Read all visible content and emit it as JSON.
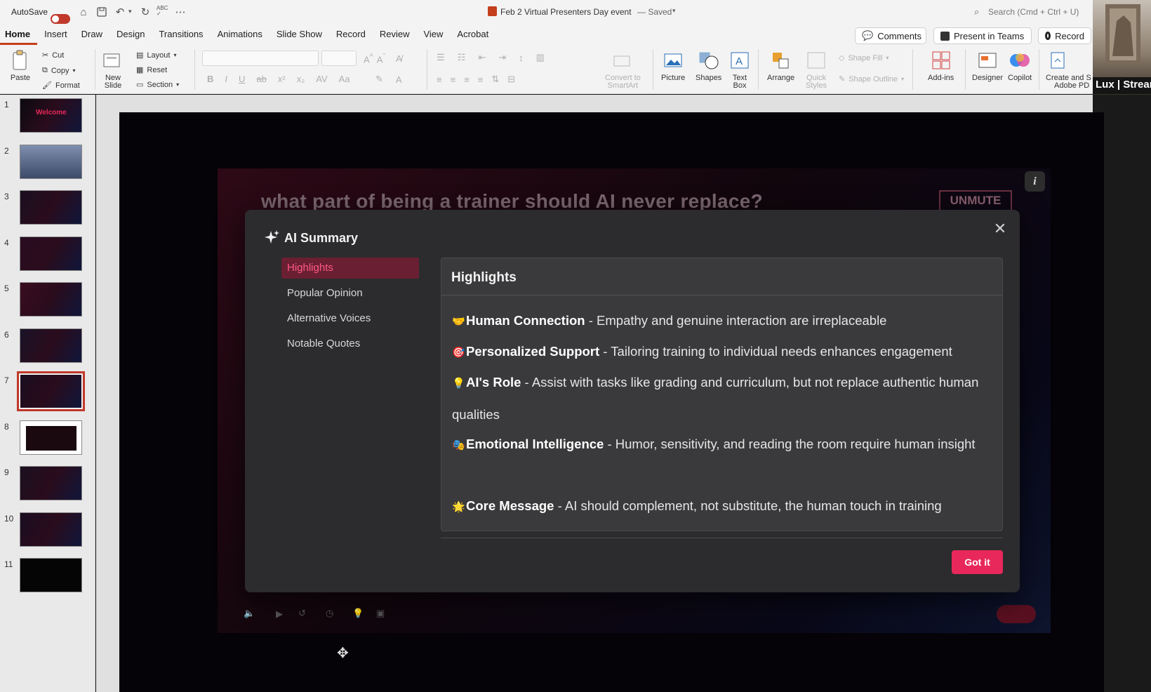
{
  "titlebar": {
    "autosave_label": "AutoSave",
    "doc_title": "Feb 2 Virtual Presenters Day event",
    "doc_status": "— Saved",
    "search_placeholder": "Search (Cmd + Ctrl + U)"
  },
  "ribbon_tabs": [
    "Home",
    "Insert",
    "Draw",
    "Design",
    "Transitions",
    "Animations",
    "Slide Show",
    "Record",
    "Review",
    "View",
    "Acrobat"
  ],
  "header_buttons": {
    "comments": "Comments",
    "present_teams": "Present in Teams",
    "record": "Record"
  },
  "ribbon": {
    "paste": "Paste",
    "cut": "Cut",
    "copy": "Copy",
    "format": "Format",
    "new_slide_1": "New",
    "new_slide_2": "Slide",
    "layout": "Layout",
    "reset": "Reset",
    "section": "Section",
    "convert_1": "Convert to",
    "convert_2": "SmartArt",
    "picture": "Picture",
    "shapes": "Shapes",
    "textbox_1": "Text",
    "textbox_2": "Box",
    "arrange": "Arrange",
    "quick_1": "Quick",
    "quick_2": "Styles",
    "shape_fill": "Shape Fill",
    "shape_outline": "Shape Outline",
    "addins": "Add-ins",
    "designer": "Designer",
    "copilot": "Copilot",
    "create_1": "Create and S",
    "create_2": "Adobe PD"
  },
  "slides": [
    {
      "num": "1",
      "label": "Welcome"
    },
    {
      "num": "2",
      "label": ""
    },
    {
      "num": "3",
      "label": ""
    },
    {
      "num": "4",
      "label": ""
    },
    {
      "num": "5",
      "label": ""
    },
    {
      "num": "6",
      "label": ""
    },
    {
      "num": "7",
      "label": ""
    },
    {
      "num": "8",
      "label": ""
    },
    {
      "num": "9",
      "label": ""
    },
    {
      "num": "10",
      "label": ""
    },
    {
      "num": "11",
      "label": ""
    }
  ],
  "selected_slide": 7,
  "slide_bg": {
    "question": "what part of being a trainer should AI never replace?",
    "logo": "UNMUTE",
    "info": "i"
  },
  "modal": {
    "title": "AI Summary",
    "nav": [
      {
        "label": "Highlights",
        "active": true
      },
      {
        "label": "Popular Opinion",
        "active": false
      },
      {
        "label": "Alternative Voices",
        "active": false
      },
      {
        "label": "Notable Quotes",
        "active": false
      }
    ],
    "panel_title": "Highlights",
    "highlights": [
      {
        "emoji": "🤝",
        "title": "Human Connection",
        "text": " - Empathy and genuine interaction are irreplaceable"
      },
      {
        "emoji": "🎯",
        "title": "Personalized Support",
        "text": " - Tailoring training to individual needs enhances engagement"
      },
      {
        "emoji": "💡",
        "title": "AI's Role",
        "text": " - Assist with tasks like grading and curriculum, but not replace authentic human qualities"
      },
      {
        "emoji": "🎭",
        "title": "Emotional Intelligence",
        "text": " - Humor, sensitivity, and reading the room require human insight"
      },
      {
        "emoji": "🌟",
        "title": "Core Message",
        "text": " - AI should complement, not substitute, the human touch in training"
      }
    ],
    "got_it": "Got it"
  },
  "webcam": {
    "label": "Lux | Strear"
  },
  "colors": {
    "accent": "#e8285a",
    "ribbon_tab_underline": "#c43e1c",
    "selected_slide_outline": "#c0392b"
  }
}
